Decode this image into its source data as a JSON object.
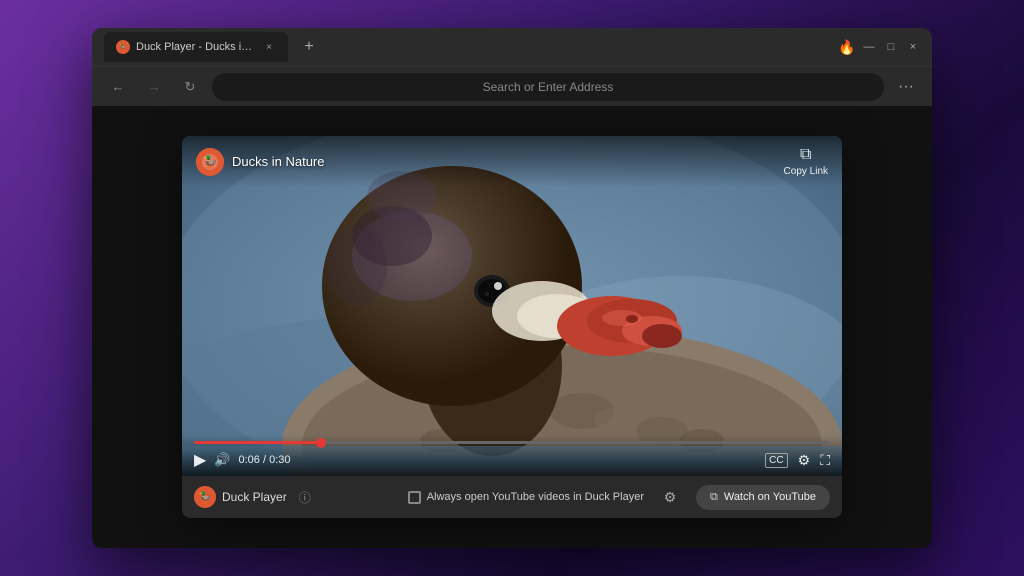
{
  "browser": {
    "tab": {
      "favicon": "🦆",
      "title": "Duck Player - Ducks in Natur...",
      "close_label": "×"
    },
    "new_tab_label": "+",
    "window_controls": {
      "flame": "🔥",
      "minimize": "—",
      "maximize": "□",
      "close": "×"
    },
    "nav": {
      "back_label": "←",
      "forward_label": "→",
      "refresh_label": "↻",
      "address_placeholder": "Search or Enter Address",
      "menu_label": "···"
    }
  },
  "duck_player": {
    "channel": {
      "name": "Ducks in Nature",
      "icon_letter": "🦆"
    },
    "copy_link": {
      "icon": "⧉",
      "label": "Copy Link"
    },
    "controls": {
      "play_icon": "▶",
      "volume_icon": "🔊",
      "time": "0:06 / 0:30",
      "captions_icon": "CC",
      "settings_icon": "⚙",
      "fullscreen_icon": "⛶"
    },
    "bottom_bar": {
      "logo_letter": "🦆",
      "player_label": "Duck Player",
      "info_icon": "ⓘ",
      "checkbox_checked": false,
      "always_open_label": "Always open YouTube videos in Duck Player",
      "settings_icon": "⚙",
      "watch_btn": {
        "icon": "⧉",
        "label": "Watch on YouTube"
      }
    }
  }
}
